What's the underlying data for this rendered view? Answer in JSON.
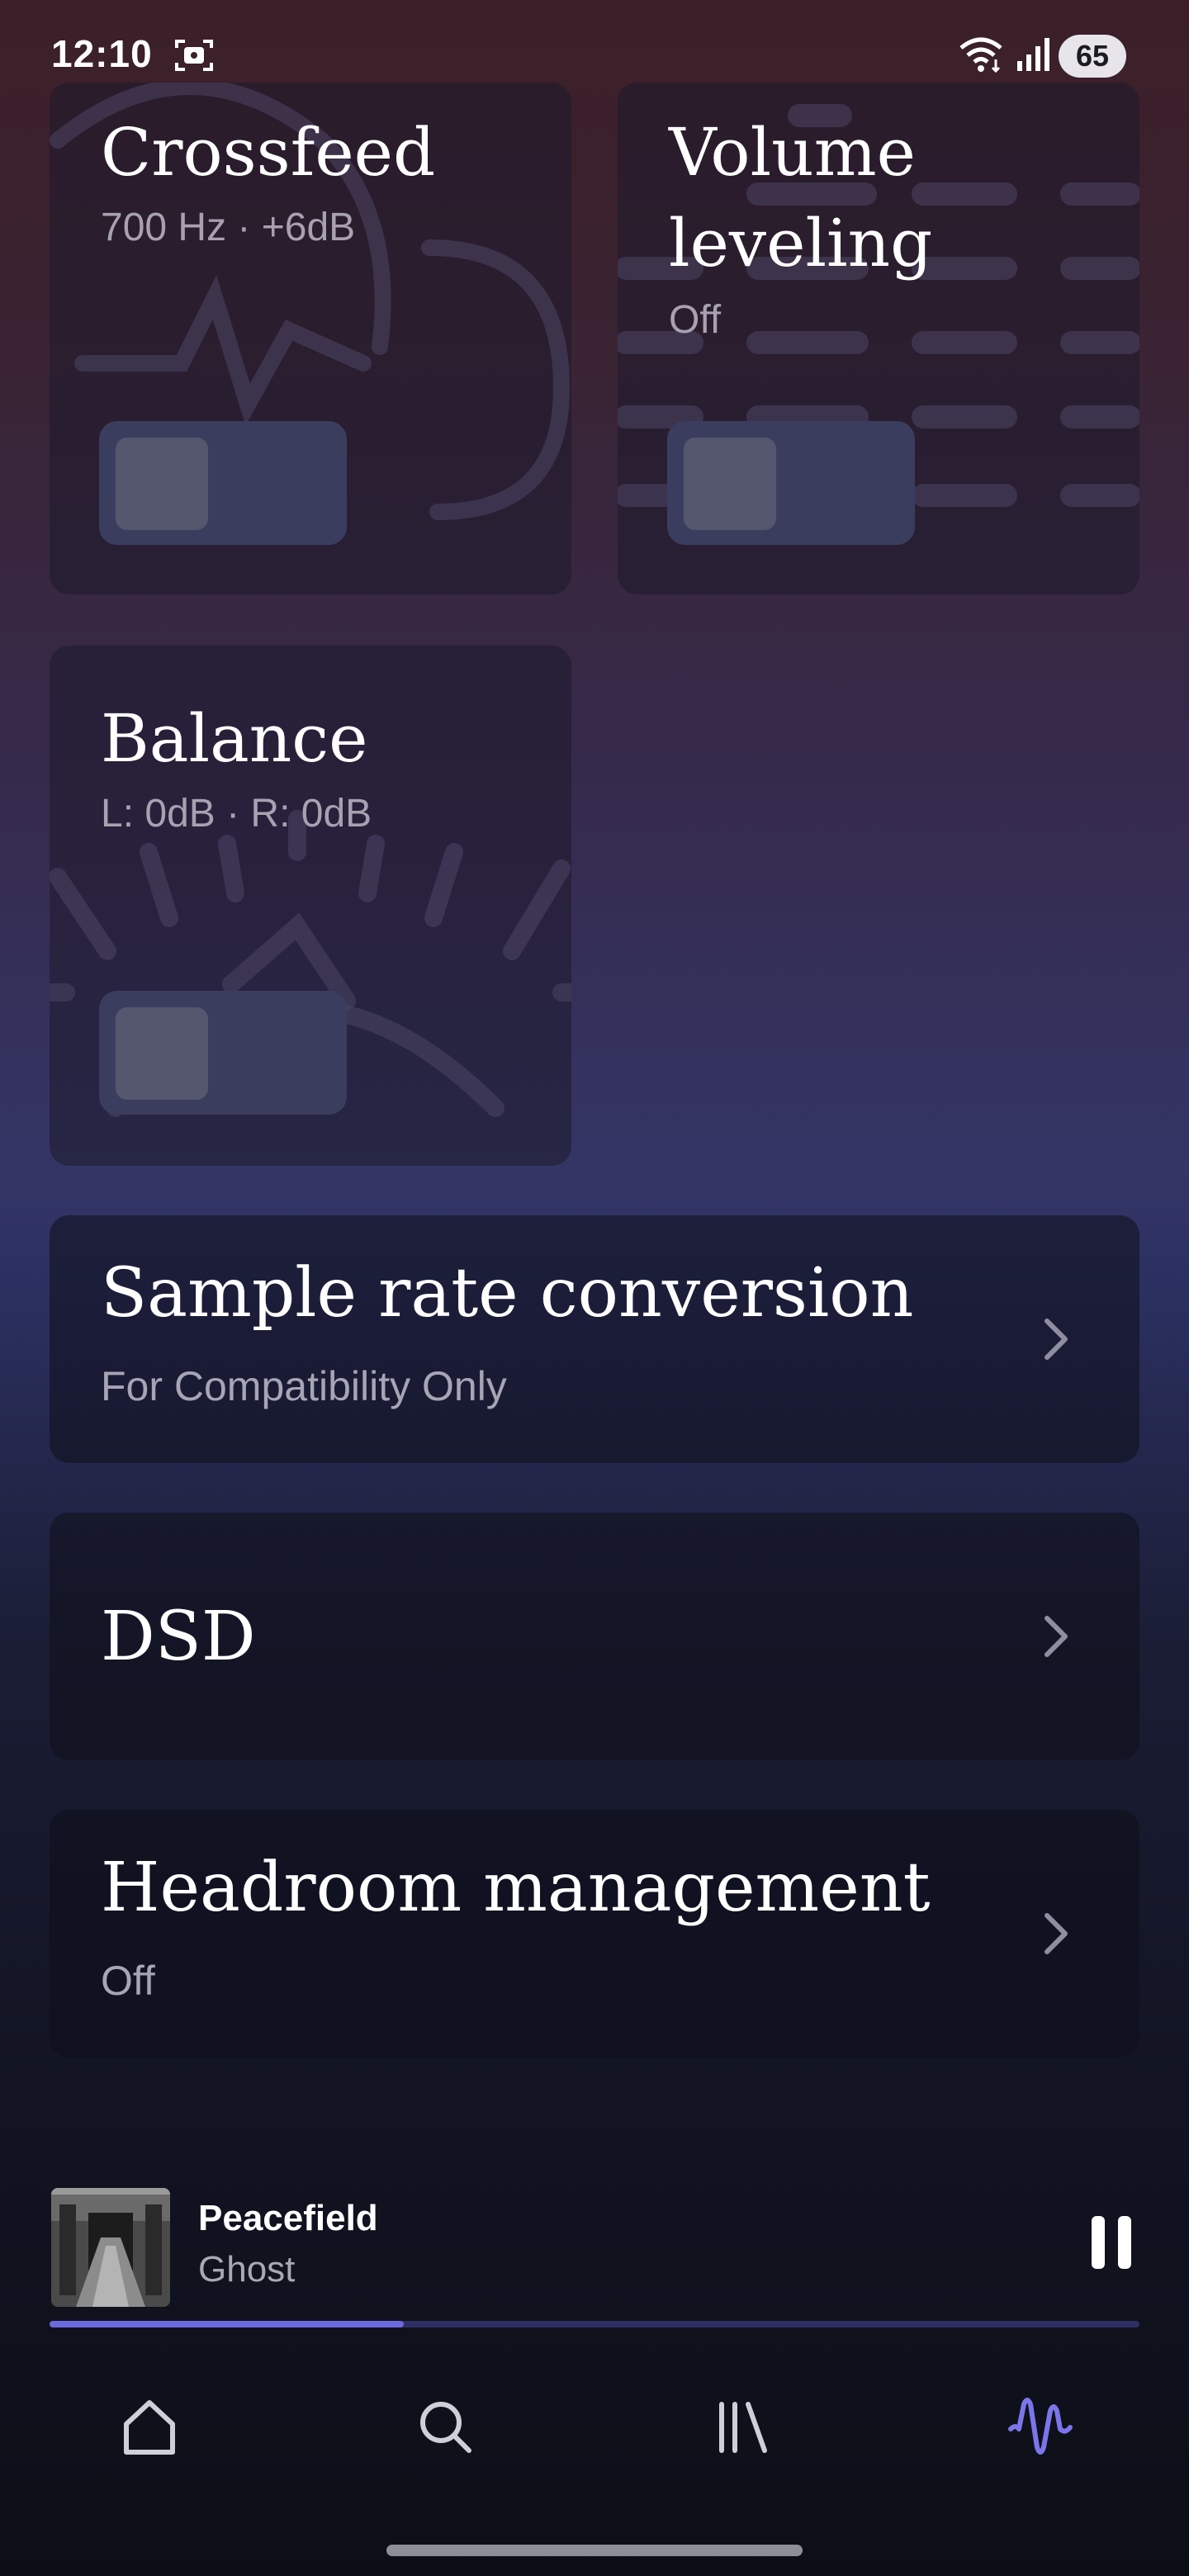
{
  "status_bar": {
    "time": "12:10",
    "battery": "65"
  },
  "tiles": [
    {
      "title": "Crossfeed",
      "subtitle": "700 Hz · +6dB",
      "enabled": false
    },
    {
      "title": "Volume leveling",
      "title_line1": "Volume",
      "title_line2": "leveling",
      "subtitle": "Off",
      "enabled": false
    },
    {
      "title": "Balance",
      "subtitle": "L: 0dB · R: 0dB",
      "enabled": false
    }
  ],
  "cards": [
    {
      "title": "Sample rate conversion",
      "subtitle": "For Compatibility Only"
    },
    {
      "title": "DSD",
      "subtitle": ""
    },
    {
      "title": "Headroom management",
      "subtitle": "Off"
    }
  ],
  "player": {
    "title": "Peacefield",
    "artist": "Ghost",
    "progress": 0.325,
    "state": "playing"
  },
  "nav": {
    "items": [
      {
        "icon": "home-icon",
        "active": false
      },
      {
        "icon": "search-icon",
        "active": false
      },
      {
        "icon": "library-icon",
        "active": false
      },
      {
        "icon": "audio-settings-icon",
        "active": true
      }
    ]
  },
  "colors": {
    "accent": "#6d6ae0",
    "toggle_off": "#3b3d5f"
  }
}
